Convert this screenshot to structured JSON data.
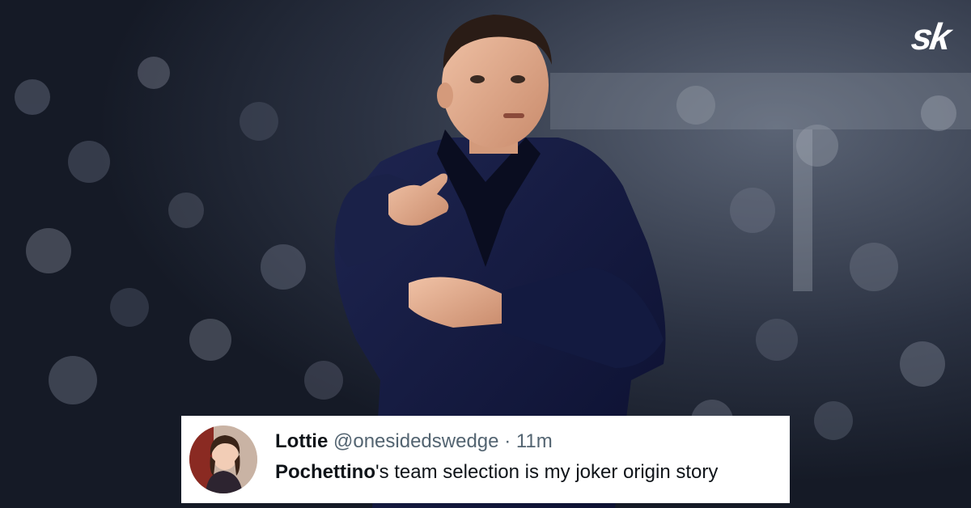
{
  "brand": {
    "logo_text": "sk"
  },
  "tweet": {
    "author_name": "Lottie",
    "author_handle": "@onesidedswedge",
    "separator": "·",
    "time": "11m",
    "text_bold": "Pochettino",
    "text_rest": "'s team selection is my joker origin story"
  },
  "colors": {
    "card_background": "#ffffff",
    "text_primary": "#0f1419",
    "text_secondary": "#536471",
    "coat": "#141a3a"
  },
  "icons": {
    "logo": "sportskeeda-logo-icon",
    "avatar": "user-avatar-photo"
  }
}
